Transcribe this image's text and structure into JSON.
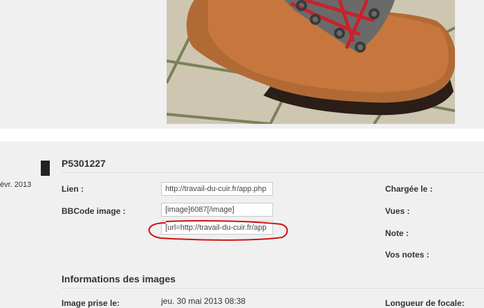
{
  "photo": {
    "icon": "boot-photo"
  },
  "left_column": {
    "date_fragment": "évr. 2013"
  },
  "image_info": {
    "title": "P5301227",
    "link_label": "Lien :",
    "link_value": "http://travail-du-cuir.fr/app.php",
    "bbcode_label": "BBCode image :",
    "bbcode_value": "[image]6087[/image]",
    "bbcode_url_value": "[url=http://travail-du-cuir.fr/app"
  },
  "right_column": {
    "uploaded_label": "Chargée le :",
    "views_label": "Vues :",
    "rating_label": "Note :",
    "your_ratings_label": "Vos notes :",
    "focal_length_label": "Longueur de focale:"
  },
  "image_details": {
    "section_title": "Informations des images",
    "taken_label": "Image prise le:",
    "taken_value": "jeu. 30 mai 2013 08:38"
  },
  "annotation": {
    "color": "#d01010"
  }
}
